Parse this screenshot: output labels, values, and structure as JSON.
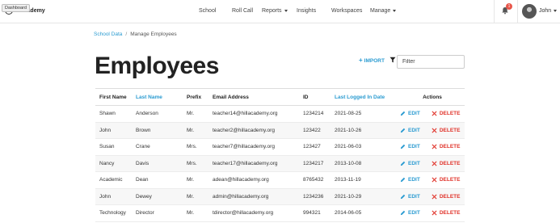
{
  "navbar": {
    "brand": "ll Academy",
    "tooltip": "Dashboard",
    "items": [
      {
        "label": "School"
      },
      {
        "label": "Roll Call"
      },
      {
        "label": "Reports"
      },
      {
        "label": "Insights"
      },
      {
        "label": "Workspaces"
      },
      {
        "label": "Manage"
      }
    ],
    "notification_count": "1",
    "user_name": "John"
  },
  "breadcrumb": {
    "root": "School Data",
    "separator": "/",
    "current": "Manage Employees"
  },
  "page": {
    "title": "Employees",
    "import_label": "IMPORT",
    "filter_placeholder": "Filter"
  },
  "table": {
    "headers": {
      "first_name": "First Name",
      "last_name": "Last Name",
      "prefix": "Prefix",
      "email": "Email Address",
      "id": "ID",
      "last_logged": "Last Logged In Date",
      "actions": "Actions"
    },
    "edit_label": "EDIT",
    "delete_label": "DELETE",
    "rows": [
      {
        "first": "Shawn",
        "last": "Anderson",
        "prefix": "Mr.",
        "email": "teacher14@hillacademy.org",
        "id": "1234214",
        "date": "2021-08-25"
      },
      {
        "first": "John",
        "last": "Brown",
        "prefix": "Mr.",
        "email": "teacher2@hillacademy.org",
        "id": "123422",
        "date": "2021-10-26"
      },
      {
        "first": "Susan",
        "last": "Crane",
        "prefix": "Mrs.",
        "email": "teacher7@hillacademy.org",
        "id": "123427",
        "date": "2021-06-03"
      },
      {
        "first": "Nancy",
        "last": "Davis",
        "prefix": "Mrs.",
        "email": "teacher17@hillacademy.org",
        "id": "1234217",
        "date": "2013-10-08"
      },
      {
        "first": "Academic",
        "last": "Dean",
        "prefix": "Mr.",
        "email": "adean@hillacademy.org",
        "id": "8765432",
        "date": "2013-11-19"
      },
      {
        "first": "John",
        "last": "Dewey",
        "prefix": "Mr.",
        "email": "admin@hillacademy.org",
        "id": "1234236",
        "date": "2021-10-29"
      },
      {
        "first": "Technology",
        "last": "Director",
        "prefix": "Mr.",
        "email": "tdirector@hillacademy.org",
        "id": "994321",
        "date": "2014-06-05"
      }
    ]
  }
}
